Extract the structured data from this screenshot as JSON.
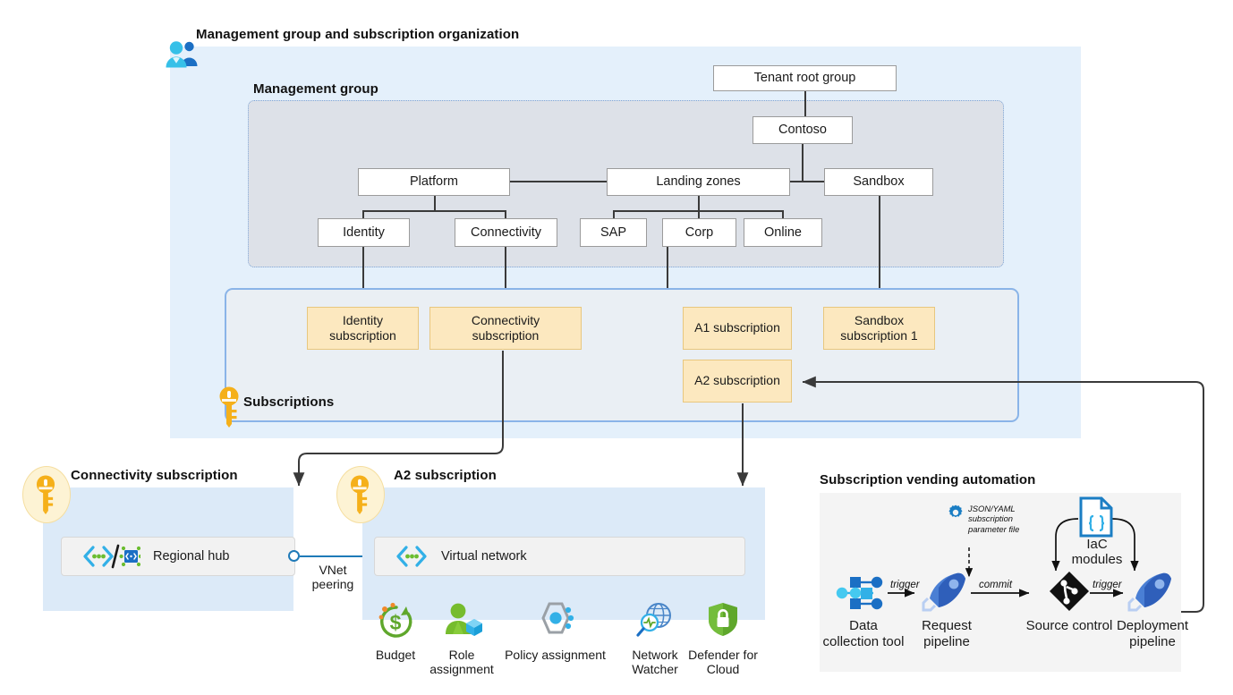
{
  "sections": {
    "org": {
      "title": "Management group and subscription organization",
      "icon": "people-icon"
    },
    "mg": {
      "title": "Management group"
    },
    "subs": {
      "title": "Subscriptions",
      "icon": "key-icon"
    },
    "conn": {
      "title": "Connectivity subscription",
      "icon": "key-icon"
    },
    "a2": {
      "title": "A2 subscription",
      "icon": "key-icon"
    },
    "vend": {
      "title": "Subscription vending automation"
    }
  },
  "management_groups": {
    "root": "Tenant root group",
    "tenant": "Contoso",
    "tier1": [
      "Platform",
      "Landing zones",
      "Sandbox"
    ],
    "platform_children": [
      "Identity",
      "Connectivity"
    ],
    "landing_zone_children": [
      "SAP",
      "Corp",
      "Online"
    ]
  },
  "subscriptions": [
    {
      "name": "Identity\nsubscription",
      "line1": "Identity",
      "line2": "subscription"
    },
    {
      "name": "Connectivity\nsubscription",
      "line1": "Connectivity",
      "line2": "subscription"
    },
    {
      "name": "A1 subscription",
      "line1": "A1 subscription",
      "line2": ""
    },
    {
      "name": "Sandbox\nsubscription 1",
      "line1": "Sandbox",
      "line2": "subscription 1"
    },
    {
      "name": "A2 subscription",
      "line1": "A2 subscription",
      "line2": ""
    }
  ],
  "connectivity_subscription": {
    "resource": "Regional hub",
    "icons": [
      "virtual-network-icon",
      "virtual-wan-hub-icon"
    ]
  },
  "a2_subscription": {
    "resource": "Virtual network",
    "resource_icon": "virtual-network-icon",
    "governance": [
      {
        "label_line1": "Budget",
        "label_line2": "",
        "icon": "budget-icon"
      },
      {
        "label_line1": "Role",
        "label_line2": "assignment",
        "icon": "role-assignment-icon"
      },
      {
        "label_line1": "Policy assignment",
        "label_line2": "",
        "icon": "policy-assignment-icon"
      },
      {
        "label_line1": "Network",
        "label_line2": "Watcher",
        "icon": "network-watcher-icon"
      },
      {
        "label_line1": "Defender for",
        "label_line2": "Cloud",
        "icon": "defender-for-cloud-icon"
      }
    ]
  },
  "peering": {
    "line1": "VNet",
    "line2": "peering"
  },
  "vending": {
    "steps": [
      {
        "line1": "Data",
        "line2": "collection tool",
        "icon": "data-collection-icon"
      },
      {
        "line1": "Request",
        "line2": "pipeline",
        "icon": "pipeline-icon"
      },
      {
        "line1": "Source control",
        "line2": "",
        "icon": "git-icon"
      },
      {
        "line1": "Deployment",
        "line2": "pipeline",
        "icon": "pipeline-icon"
      }
    ],
    "arrow_labels": [
      "trigger",
      "commit",
      "trigger"
    ],
    "parameter_file": {
      "line1": "JSON/YAML",
      "line2": "subscription",
      "line3": "parameter file",
      "icon": "gear-icon"
    },
    "iac": {
      "line1": "IaC",
      "line2": "modules",
      "icon": "json-file-icon"
    }
  },
  "colors": {
    "panel_outer": "#e4f0fb",
    "panel_mg": "#dde1e8",
    "panel_subs": "#eaeff4",
    "panel_light": "#dceaf8",
    "panel_grey": "#f4f4f4",
    "subscription_fill": "#fce8bf",
    "accent_blue": "#1f7ab8",
    "key_yellow": "#f5b01a",
    "green": "#5fa72c"
  }
}
